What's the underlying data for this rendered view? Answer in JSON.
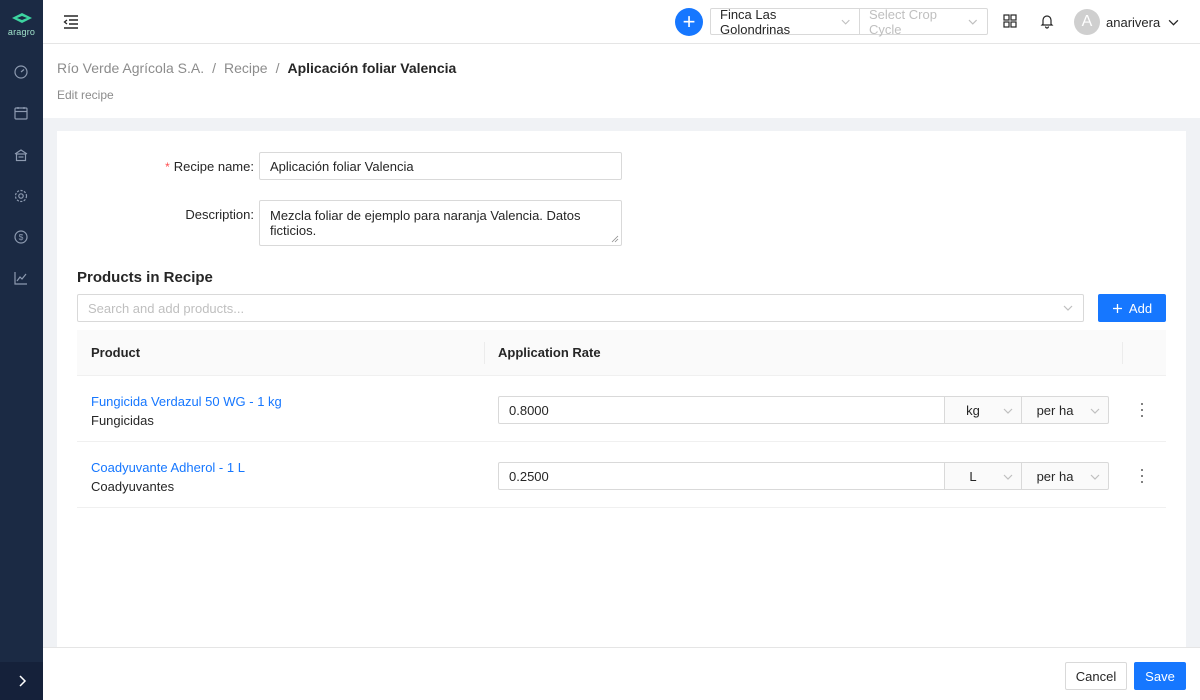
{
  "app": {
    "logo_text": "aragro"
  },
  "sidebar": {
    "items": [
      {
        "icon": "dashboard-icon"
      },
      {
        "icon": "calendar-icon"
      },
      {
        "icon": "warehouse-icon"
      },
      {
        "icon": "settings-icon"
      },
      {
        "icon": "dollar-icon"
      },
      {
        "icon": "chart-icon"
      }
    ],
    "expand_icon": "chevron-right-icon"
  },
  "topbar": {
    "farm_select": "Finca Las Golondrinas",
    "crop_cycle_placeholder": "Select Crop Cycle",
    "user": {
      "initial": "A",
      "name": "anarivera"
    }
  },
  "breadcrumb": {
    "items": [
      "Río Verde Agrícola S.A.",
      "Recipe",
      "Aplicación foliar Valencia"
    ],
    "separator": "/"
  },
  "page": {
    "subtitle": "Edit recipe"
  },
  "form": {
    "recipe_name_label": "Recipe name",
    "recipe_name_value": "Aplicación foliar Valencia",
    "description_label": "Description",
    "description_value": "Mezcla foliar de ejemplo para naranja Valencia. Datos ficticios."
  },
  "products": {
    "section_title": "Products in Recipe",
    "search_placeholder": "Search and add products...",
    "add_label": "Add",
    "columns": [
      "Product",
      "Application Rate"
    ],
    "rows": [
      {
        "name": "Fungicida Verdazul 50 WG - 1 kg",
        "category": "Fungicidas",
        "rate": "0.8000",
        "unit": "kg",
        "per": "per ha"
      },
      {
        "name": "Coadyuvante Adherol - 1 L",
        "category": "Coadyuvantes",
        "rate": "0.2500",
        "unit": "L",
        "per": "per ha"
      }
    ]
  },
  "footer": {
    "cancel_label": "Cancel",
    "save_label": "Save"
  },
  "colors": {
    "primary": "#1677ff",
    "sidebar": "#1b2a44",
    "required": "#ff4d4f",
    "logo": "#3dd4a0"
  }
}
